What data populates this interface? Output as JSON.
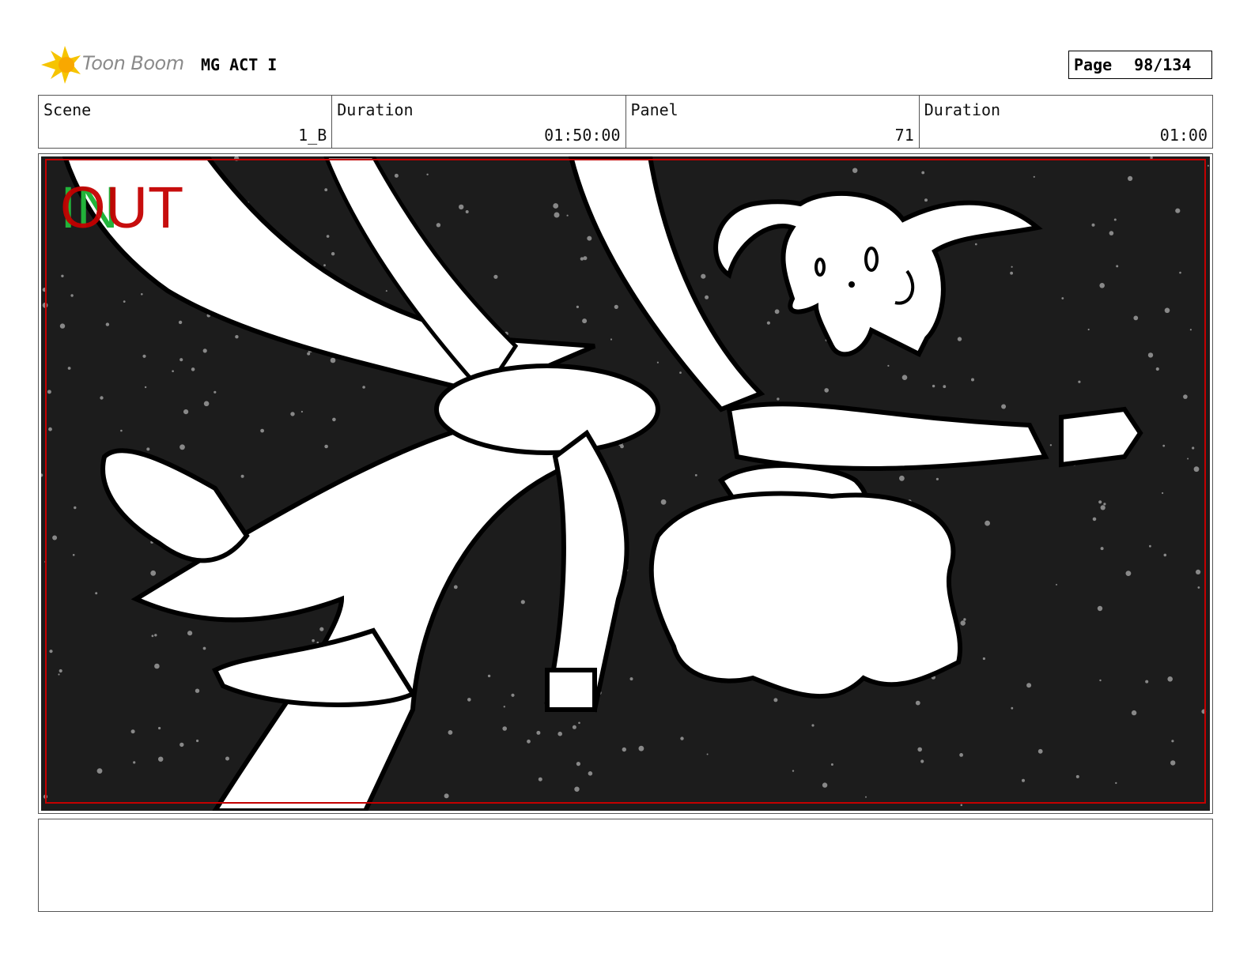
{
  "header": {
    "logo_text": "Toon Boom",
    "project_title": "MG ACT I",
    "page_label": "Page",
    "page_number": "98/134"
  },
  "info": [
    {
      "label": "Scene",
      "value": "1_B"
    },
    {
      "label": "Duration",
      "value": "01:50:00"
    },
    {
      "label": "Panel",
      "value": "71"
    },
    {
      "label": "Duration",
      "value": "01:00"
    }
  ],
  "panel": {
    "in_marker": "IN",
    "out_marker": "OUT",
    "colors": {
      "in": "#22b33a",
      "out": "#c40000",
      "safe_frame": "#c40000",
      "background": "#1c1c1c"
    }
  },
  "notes": {
    "text": ""
  }
}
